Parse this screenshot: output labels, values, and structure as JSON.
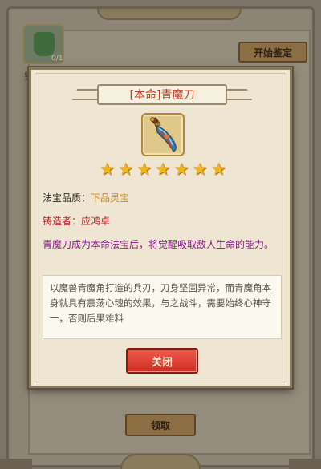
{
  "background": {
    "item_count": "0/1",
    "item_label": "鉴",
    "start_button": "开始鉴定",
    "claim_button": "领取"
  },
  "modal": {
    "title": "[本命]青魔刀",
    "star_count": 7,
    "stars": [
      "★",
      "★",
      "★",
      "★",
      "★",
      "★",
      "★"
    ],
    "quality_label": "法宝品质：",
    "quality_value": "下品灵宝",
    "maker": "铸造者：应鸿卓",
    "effect_text": "青魔刀成为本命法宝后，将觉醒吸取敌人生命的能力。",
    "lore_text": "以魔兽青魔角打造的兵刃，刀身坚固异常，而青魔角本身就具有震荡心魂的效果，与之战斗，需要始终心神守一，否则后果难料",
    "close_button": "关闭"
  },
  "colors": {
    "title": "#c8402a",
    "quality_value": "#d08a1a",
    "maker": "#c0242a",
    "effect": "#8a1c8c",
    "close_button": "#e0402f"
  },
  "icons": {
    "item": "blade-icon",
    "star": "star-icon"
  }
}
